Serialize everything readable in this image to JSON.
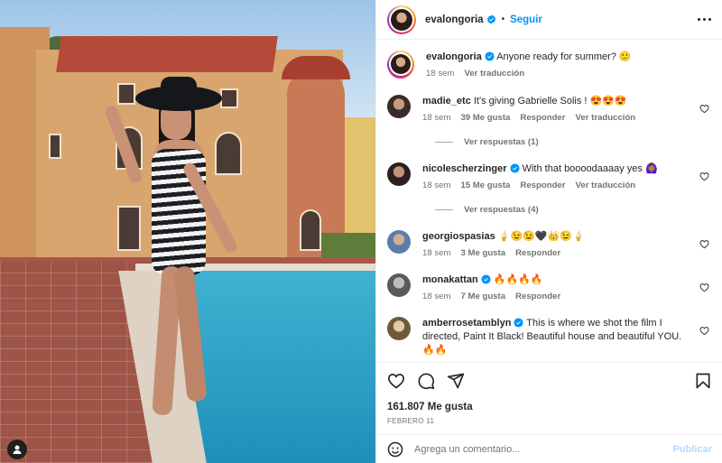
{
  "post": {
    "author": "evalongoria",
    "follow_label": "Seguir",
    "separator": "•",
    "caption": "Anyone ready for summer? 🙂",
    "caption_time": "18 sem",
    "caption_translate": "Ver traducción"
  },
  "comments": [
    {
      "user": "madie_etc",
      "verified": false,
      "text": "It's giving Gabrielle Solis ! 😍😍😍",
      "time": "18 sem",
      "likes": "39 Me gusta",
      "reply": "Responder",
      "translate": "Ver traducción",
      "replies_label": "Ver respuestas (1)",
      "avatar_color": "#3a2b26"
    },
    {
      "user": "nicolescherzinger",
      "verified": true,
      "text": "With that boooodaaaay yes 🙆🏽‍♀️",
      "time": "18 sem",
      "likes": "15 Me gusta",
      "reply": "Responder",
      "translate": "Ver traducción",
      "replies_label": "Ver respuestas (4)",
      "avatar_color": "#2b2020"
    },
    {
      "user": "georgiospasias",
      "verified": false,
      "text": "🍦😉😉🖤👑😉🍦",
      "time": "18 sem",
      "likes": "3 Me gusta",
      "reply": "Responder",
      "translate": "",
      "replies_label": "",
      "avatar_color": "#5b7ea8"
    },
    {
      "user": "monakattan",
      "verified": true,
      "text": "🔥🔥🔥🔥",
      "time": "18 sem",
      "likes": "7 Me gusta",
      "reply": "Responder",
      "translate": "",
      "replies_label": "",
      "avatar_color": "#5a5a5a"
    },
    {
      "user": "amberrosetamblyn",
      "verified": true,
      "text": "This is where we shot the film I directed, Paint It Black! Beautiful house and beautiful YOU. 🔥🔥",
      "time": "",
      "likes": "",
      "reply": "",
      "translate": "",
      "replies_label": "",
      "avatar_color": "#6d5a3b"
    }
  ],
  "footer": {
    "likes": "161.807 Me gusta",
    "date": "FEBRERO 11",
    "comment_placeholder": "Agrega un comentario...",
    "publish_label": "Publicar"
  },
  "icons": {
    "verified": "verified-badge-icon",
    "like": "heart-icon",
    "comment": "comment-icon",
    "share": "share-icon",
    "save": "bookmark-icon",
    "emoji": "emoji-icon",
    "more": "more-options-icon",
    "tagged_user": "user-icon"
  },
  "colors": {
    "accent": "#0095f6",
    "verified": "#0095f6",
    "publish_disabled": "#b3dbff",
    "muted": "#737373"
  }
}
